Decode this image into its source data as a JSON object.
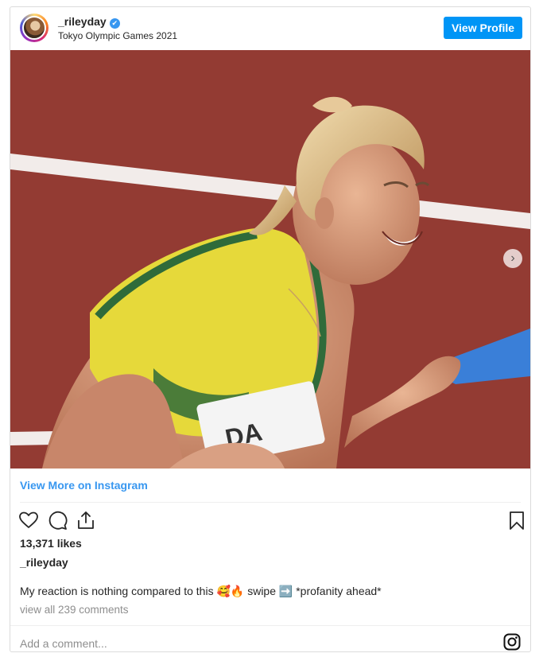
{
  "post": {
    "username": "_rileyday",
    "verified_mark": "✔",
    "location": "Tokyo Olympic Games 2021",
    "view_profile_label": "View Profile",
    "view_more_label": "View More on Instagram",
    "likes_text": "13,371 likes",
    "caption_user": "_rileyday",
    "caption_text": "My reaction is nothing compared to this 🥰🔥 swipe ➡️ *profanity ahead*",
    "comments_link": "view all 239 comments",
    "comment_placeholder": "Add a comment...",
    "next_arrow": "›"
  },
  "icons": {
    "like": "heart-icon",
    "comment": "comment-bubble-icon",
    "share": "share-icon",
    "save": "bookmark-icon",
    "instagram": "instagram-icon",
    "verified": "verified-badge-icon"
  },
  "colors": {
    "accent": "#0095f6",
    "link": "#3897f0",
    "muted": "#8e8e8e",
    "track": "#9b3f37",
    "jersey": "#e6d93a"
  }
}
